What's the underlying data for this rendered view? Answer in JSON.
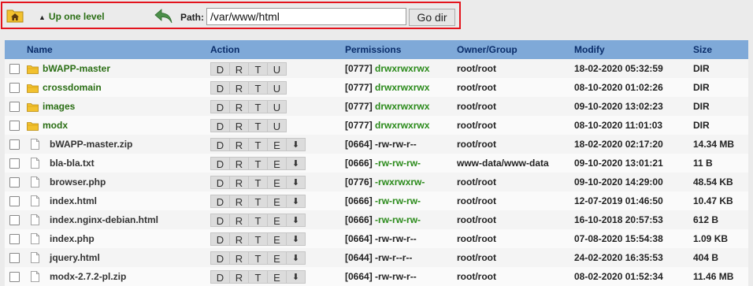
{
  "toolbar": {
    "up_label": "Up one level",
    "path_label": "Path:",
    "path_value": "/var/www/html",
    "go_label": "Go dir"
  },
  "table": {
    "headers": {
      "name": "Name",
      "action": "Action",
      "permissions": "Permissions",
      "owner": "Owner/Group",
      "modify": "Modify",
      "size": "Size"
    },
    "rows": [
      {
        "name": "bWAPP-master",
        "type": "dir",
        "perm_code": "[0777]",
        "perm_str": "drwxrwxrwx",
        "perm_color": "green",
        "owner": "root/root",
        "modify": "18-02-2020 05:32:59",
        "size": "DIR"
      },
      {
        "name": "crossdomain",
        "type": "dir",
        "perm_code": "[0777]",
        "perm_str": "drwxrwxrwx",
        "perm_color": "green",
        "owner": "root/root",
        "modify": "08-10-2020 01:02:26",
        "size": "DIR"
      },
      {
        "name": "images",
        "type": "dir",
        "perm_code": "[0777]",
        "perm_str": "drwxrwxrwx",
        "perm_color": "green",
        "owner": "root/root",
        "modify": "09-10-2020 13:02:23",
        "size": "DIR"
      },
      {
        "name": "modx",
        "type": "dir",
        "perm_code": "[0777]",
        "perm_str": "drwxrwxrwx",
        "perm_color": "green",
        "owner": "root/root",
        "modify": "08-10-2020 11:01:03",
        "size": "DIR"
      },
      {
        "name": "bWAPP-master.zip",
        "type": "file",
        "perm_code": "[0664]",
        "perm_str": "-rw-rw-r--",
        "perm_color": "plain",
        "owner": "root/root",
        "modify": "18-02-2020 02:17:20",
        "size": "14.34 MB"
      },
      {
        "name": "bla-bla.txt",
        "type": "file",
        "perm_code": "[0666]",
        "perm_str": "-rw-rw-rw-",
        "perm_color": "green",
        "owner": "www-data/www-data",
        "modify": "09-10-2020 13:01:21",
        "size": "11 B"
      },
      {
        "name": "browser.php",
        "type": "file",
        "perm_code": "[0776]",
        "perm_str": "-rwxrwxrw-",
        "perm_color": "green",
        "owner": "root/root",
        "modify": "09-10-2020 14:29:00",
        "size": "48.54 KB"
      },
      {
        "name": "index.html",
        "type": "file",
        "perm_code": "[0666]",
        "perm_str": "-rw-rw-rw-",
        "perm_color": "green",
        "owner": "root/root",
        "modify": "12-07-2019 01:46:50",
        "size": "10.47 KB"
      },
      {
        "name": "index.nginx-debian.html",
        "type": "file",
        "perm_code": "[0666]",
        "perm_str": "-rw-rw-rw-",
        "perm_color": "green",
        "owner": "root/root",
        "modify": "16-10-2018 20:57:53",
        "size": "612 B"
      },
      {
        "name": "index.php",
        "type": "file",
        "perm_code": "[0664]",
        "perm_str": "-rw-rw-r--",
        "perm_color": "plain",
        "owner": "root/root",
        "modify": "07-08-2020 15:54:38",
        "size": "1.09 KB"
      },
      {
        "name": "jquery.html",
        "type": "file",
        "perm_code": "[0644]",
        "perm_str": "-rw-r--r--",
        "perm_color": "plain",
        "owner": "root/root",
        "modify": "24-02-2020 16:35:53",
        "size": "404 B"
      },
      {
        "name": "modx-2.7.2-pl.zip",
        "type": "file",
        "perm_code": "[0664]",
        "perm_str": "-rw-rw-r--",
        "perm_color": "plain",
        "owner": "root/root",
        "modify": "08-02-2020 01:52:34",
        "size": "11.46 MB"
      }
    ],
    "dir_actions": [
      "D",
      "R",
      "T",
      "U"
    ],
    "file_actions": [
      "D",
      "R",
      "T",
      "E",
      "⬇"
    ]
  },
  "icons": {
    "home": "home-icon",
    "back": "back-arrow-icon",
    "folder": "folder-icon",
    "file": "file-icon"
  },
  "colors": {
    "header_bg": "#7fa9d8",
    "dir_green": "#2a6e14",
    "perm_green": "#2a8a1a",
    "highlight_border": "#e3141d"
  }
}
